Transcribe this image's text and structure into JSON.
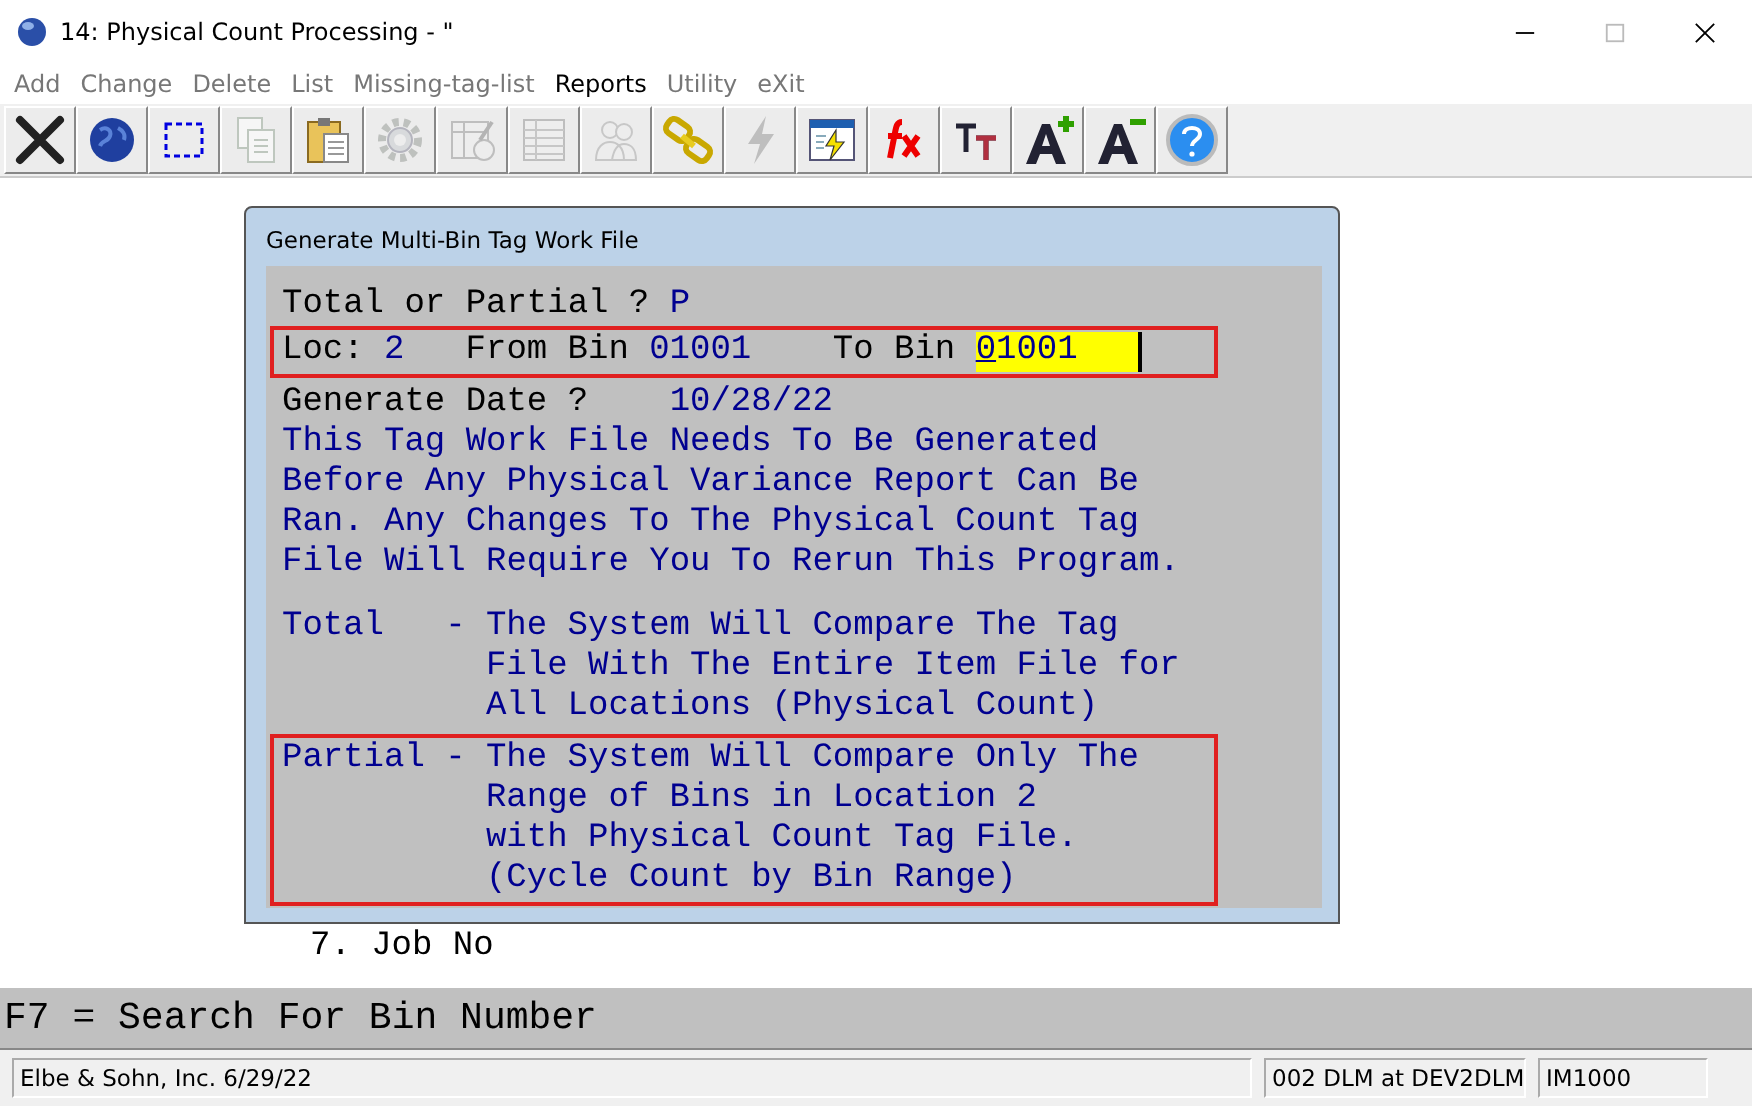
{
  "window": {
    "title": "14: Physical Count Processing -   \""
  },
  "menu": [
    {
      "label": "Add",
      "disabled": true
    },
    {
      "label": "Change",
      "disabled": true
    },
    {
      "label": "Delete",
      "disabled": true
    },
    {
      "label": "List",
      "disabled": true
    },
    {
      "label": "Missing-tag-list",
      "disabled": true
    },
    {
      "label": "Reports",
      "disabled": false
    },
    {
      "label": "Utility",
      "disabled": true
    },
    {
      "label": "eXit",
      "disabled": true
    }
  ],
  "toolbar": [
    {
      "kind": "close",
      "disabled": false
    },
    {
      "kind": "globe",
      "disabled": false
    },
    {
      "kind": "select",
      "disabled": false
    },
    {
      "kind": "copy",
      "disabled": true
    },
    {
      "kind": "paste",
      "disabled": false
    },
    {
      "kind": "gear",
      "disabled": true
    },
    {
      "kind": "form",
      "disabled": true
    },
    {
      "kind": "table",
      "disabled": true
    },
    {
      "kind": "people",
      "disabled": true
    },
    {
      "kind": "chain",
      "disabled": false
    },
    {
      "kind": "lightning",
      "disabled": true
    },
    {
      "kind": "calendar",
      "disabled": false
    },
    {
      "kind": "function",
      "disabled": false
    },
    {
      "kind": "font",
      "disabled": false
    },
    {
      "kind": "grow",
      "disabled": false
    },
    {
      "kind": "shrink",
      "disabled": false
    },
    {
      "kind": "help",
      "disabled": false
    }
  ],
  "background_lines": [
    "7. Job No"
  ],
  "dialog": {
    "title": "Generate Multi-Bin Tag Work File",
    "prompt": {
      "label": "Total or Partial ?",
      "value": "P"
    },
    "range": {
      "highlighted": true,
      "loc_label": "Loc:",
      "loc": "2",
      "from_label": "From Bin",
      "from": "01001",
      "to_label": "To Bin",
      "to": "01001"
    },
    "date": {
      "label": "Generate Date ?",
      "value": "10/28/22"
    },
    "notice": [
      "This Tag Work File Needs To Be Generated",
      "Before Any Physical Variance Report Can Be",
      "Ran. Any Changes To The Physical Count Tag",
      "File Will Require You To Rerun This Program."
    ],
    "options": [
      {
        "name": "Total",
        "dash": "-",
        "highlighted": false,
        "lines": [
          "The System Will Compare The Tag",
          "File With The Entire Item File for",
          "All Locations (Physical Count)"
        ]
      },
      {
        "name": "Partial",
        "dash": "-",
        "highlighted": true,
        "lines": [
          "The System Will Compare Only The",
          "Range of Bins in Location 2",
          "with Physical Count Tag File.",
          "(Cycle Count by Bin Range)"
        ]
      }
    ]
  },
  "function_key_hint": "F7 = Search For Bin Number",
  "status_bar": [
    "Elbe & Sohn, Inc. 6/29/22",
    "002 DLM at DEV2DLM",
    "IM1000"
  ]
}
